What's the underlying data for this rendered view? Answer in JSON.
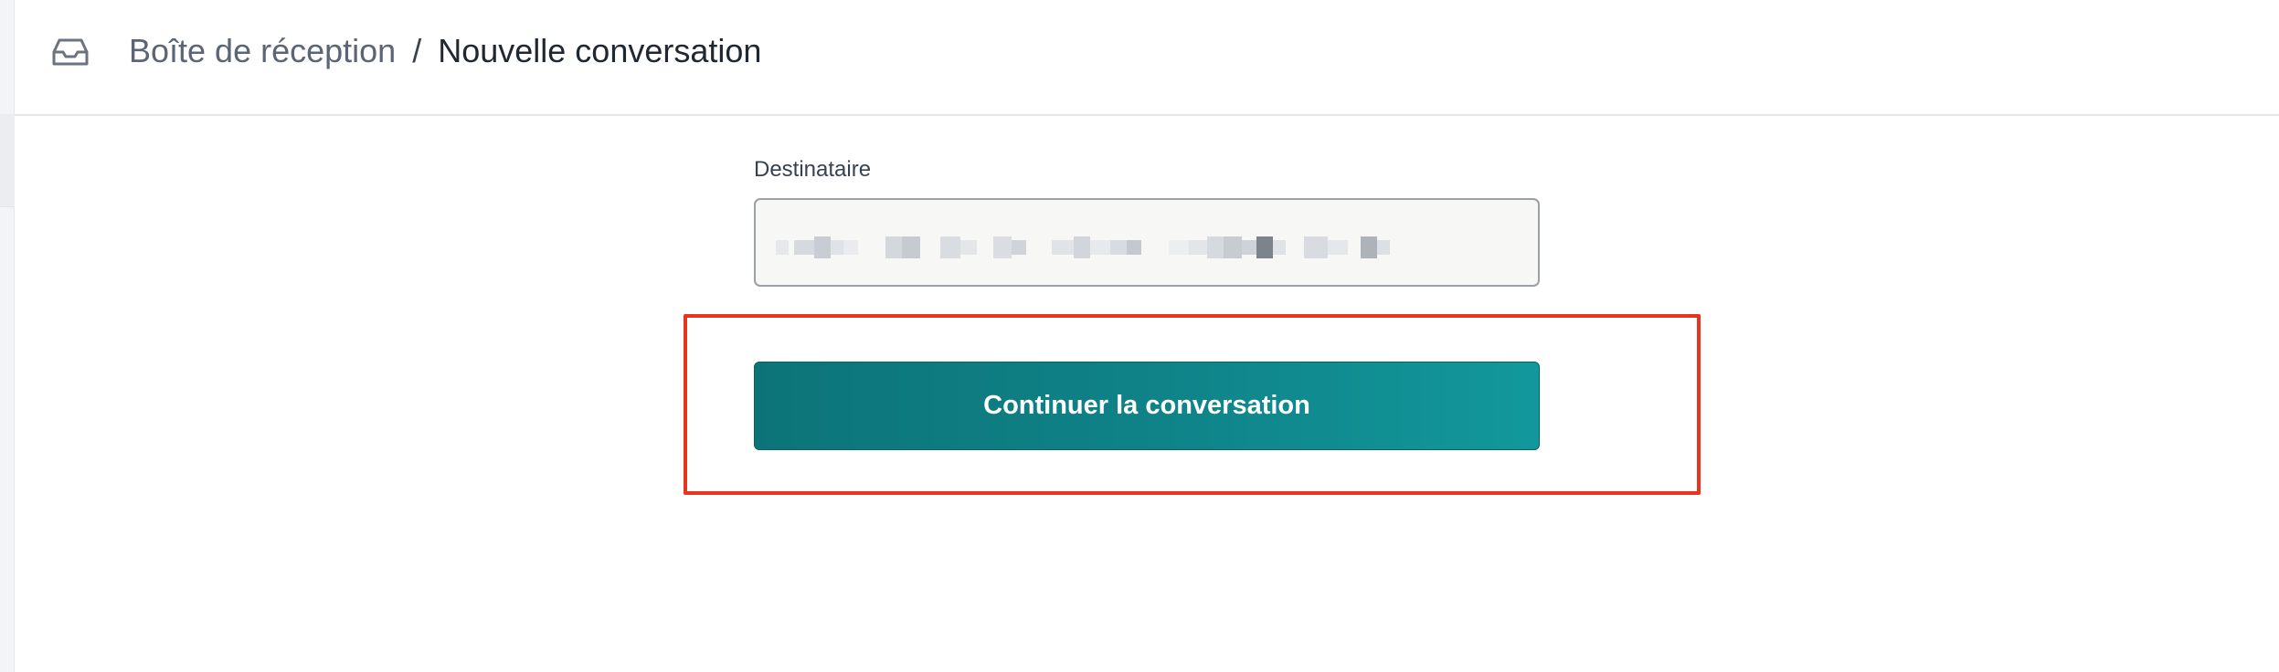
{
  "header": {
    "icon": "inbox-icon",
    "breadcrumb": {
      "parent": "Boîte de réception",
      "separator": "/",
      "current": "Nouvelle conversation"
    }
  },
  "form": {
    "recipient": {
      "label": "Destinataire",
      "value_redacted": true
    },
    "continue_button": {
      "label": "Continuer la conversation",
      "color": "#0f8489"
    }
  },
  "annotation": {
    "highlight_color": "#e8341c",
    "target": "continue-button"
  }
}
